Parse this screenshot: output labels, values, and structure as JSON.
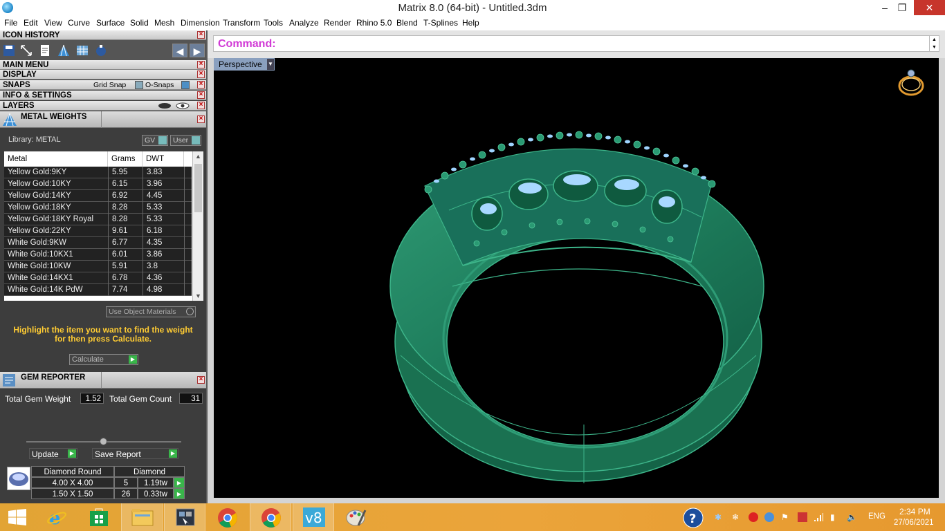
{
  "window": {
    "title": "Matrix 8.0 (64-bit) - Untitled.3dm",
    "minimize": "–",
    "maximize": "❐",
    "close": "✕"
  },
  "menu": [
    "File",
    "Edit",
    "View",
    "Curve",
    "Surface",
    "Solid",
    "Mesh",
    "Dimension",
    "Transform",
    "Tools",
    "Analyze",
    "Render",
    "Rhino 5.0",
    "Blend",
    "T-Splines",
    "Help"
  ],
  "panels": {
    "icon_history": "ICON HISTORY",
    "main_menu": "MAIN MENU",
    "display": "DISPLAY",
    "snaps": "SNAPS",
    "grid_snap": "Grid Snap",
    "osnaps": "O-Snaps",
    "info": "INFO & SETTINGS",
    "layers": "LAYERS"
  },
  "metal": {
    "title": "METAL WEIGHTS",
    "library": "Library: METAL",
    "gv": "GV",
    "user": "User",
    "headers": [
      "Metal",
      "Grams",
      "DWT"
    ],
    "rows": [
      {
        "metal": "Yellow Gold:9KY",
        "grams": "5.95",
        "dwt": "3.83"
      },
      {
        "metal": "Yellow Gold:10KY",
        "grams": "6.15",
        "dwt": "3.96"
      },
      {
        "metal": "Yellow Gold:14KY",
        "grams": "6.92",
        "dwt": "4.45"
      },
      {
        "metal": "Yellow Gold:18KY",
        "grams": "8.28",
        "dwt": "5.33"
      },
      {
        "metal": "Yellow Gold:18KY Royal",
        "grams": "8.28",
        "dwt": "5.33"
      },
      {
        "metal": "Yellow Gold:22KY",
        "grams": "9.61",
        "dwt": "6.18"
      },
      {
        "metal": "White Gold:9KW",
        "grams": "6.77",
        "dwt": "4.35"
      },
      {
        "metal": "White Gold:10KX1",
        "grams": "6.01",
        "dwt": "3.86"
      },
      {
        "metal": "White Gold:10KW",
        "grams": "5.91",
        "dwt": "3.8"
      },
      {
        "metal": "White Gold:14KX1",
        "grams": "6.78",
        "dwt": "4.36"
      },
      {
        "metal": "White Gold:14K PdW",
        "grams": "7.74",
        "dwt": "4.98"
      }
    ],
    "use_object_materials": "Use Object Materials",
    "hint": "Highlight the item you want to find the weight for then press Calculate.",
    "calculate": "Calculate"
  },
  "gem": {
    "title": "GEM REPORTER",
    "total_weight_label": "Total Gem Weight",
    "total_weight": "1.52",
    "total_count_label": "Total Gem Count",
    "total_count": "31",
    "update": "Update",
    "save_report": "Save Report",
    "shape": "Diamond Round",
    "material": "Diamond",
    "rows": [
      {
        "size": "4.00 X 4.00",
        "count": "5",
        "weight": "1.19tw"
      },
      {
        "size": "1.50 X 1.50",
        "count": "26",
        "weight": "0.33tw"
      }
    ]
  },
  "command": {
    "label": "Command:"
  },
  "viewport": {
    "name": "Perspective"
  },
  "taskbar": {
    "lang": "ENG",
    "time": "2:34 PM",
    "date": "27/06/2021"
  },
  "colors": {
    "ring": "#1f7a5c",
    "gem": "#9fd4ff",
    "taskbar": "#e9a13a",
    "command": "#d13ad6",
    "hint": "#ffcc33"
  }
}
